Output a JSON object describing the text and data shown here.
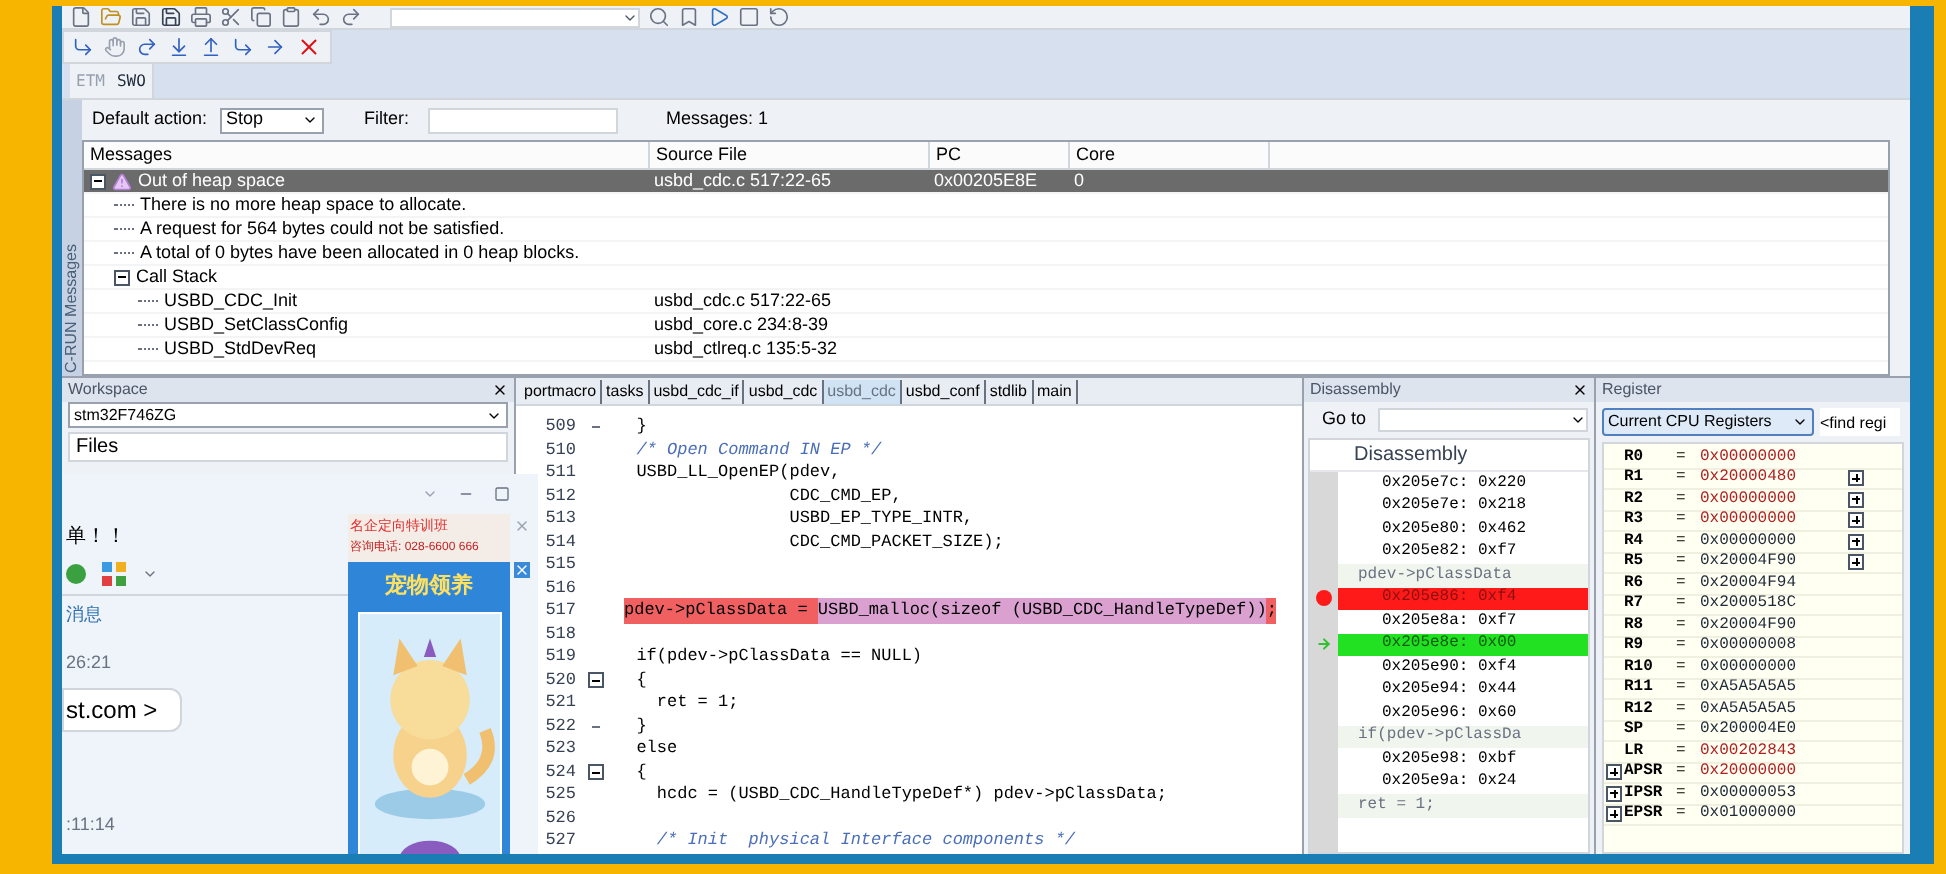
{
  "toolbar_tabs": [
    {
      "label": "ETM",
      "disabled": true
    },
    {
      "label": "SWO",
      "disabled": false
    }
  ],
  "messages_panel": {
    "title": "C-RUN Messages",
    "default_action": {
      "label": "Default action:",
      "value": "Stop"
    },
    "filter": {
      "label": "Filter:"
    },
    "count": "Messages: 1",
    "columns": [
      "Messages",
      "Source File",
      "PC",
      "Core"
    ],
    "rows": [
      {
        "kind": "warning",
        "message": "Out of heap space",
        "source": "usbd_cdc.c 517:22-65",
        "pc": "0x00205E8E",
        "core": "0",
        "selected": true,
        "expanded": true,
        "children": [
          {
            "kind": "text",
            "message": "There is no more heap space to allocate.",
            "selected": false
          },
          {
            "kind": "text",
            "message": "A request for 564 bytes could not be satisfied.",
            "selected": false
          },
          {
            "kind": "text",
            "message": "A total of 0 bytes have been allocated in 0 heap blocks.",
            "selected": false
          },
          {
            "kind": "group",
            "message": "Call Stack",
            "selected": false,
            "expanded": true,
            "children": [
              {
                "kind": "text",
                "message": "USBD_CDC_Init",
                "source": "usbd_cdc.c 517:22-65",
                "selected": false
              },
              {
                "kind": "text",
                "message": "USBD_SetClassConfig",
                "source": "usbd_core.c 234:8-39",
                "selected": false
              },
              {
                "kind": "text",
                "message": "USBD_StdDevReq",
                "source": "usbd_ctlreq.c 135:5-32",
                "selected": false
              }
            ]
          }
        ]
      }
    ]
  },
  "workspace": {
    "title": "Workspace",
    "project": "stm32F746ZG",
    "files_label": "Files"
  },
  "chat_window": {
    "heading": "单！！",
    "link": "消息",
    "time_1": "26:21",
    "bubble": "st.com >",
    "time_2": ":11:14",
    "ad": {
      "line_1": "名企定向特训班",
      "line_2": "咨询电话: 028-6600 666",
      "banner": "宠物领养"
    }
  },
  "editor": {
    "tabs": [
      {
        "label": "portmacro",
        "selected": false
      },
      {
        "label": "tasks",
        "selected": false
      },
      {
        "label": "usbd_cdc_if",
        "selected": false
      },
      {
        "label": "usbd_cdc",
        "selected": false
      },
      {
        "label": "usbd_cdc",
        "selected": true
      },
      {
        "label": "usbd_conf",
        "selected": false
      },
      {
        "label": "stdlib",
        "selected": false
      },
      {
        "label": "main",
        "selected": false
      }
    ],
    "lines": [
      {
        "number": "509",
        "fold_start": false,
        "fold_end": true,
        "kind": "code",
        "text": "  }"
      },
      {
        "number": "510",
        "fold_start": false,
        "fold_end": false,
        "kind": "comment",
        "text": "  /* Open Command IN EP */"
      },
      {
        "number": "511",
        "fold_start": false,
        "fold_end": false,
        "kind": "code",
        "text": "  USBD_LL_OpenEP(pdev,"
      },
      {
        "number": "512",
        "fold_start": false,
        "fold_end": false,
        "kind": "code",
        "text": "                 CDC_CMD_EP,"
      },
      {
        "number": "513",
        "fold_start": false,
        "fold_end": false,
        "kind": "code",
        "text": "                 USBD_EP_TYPE_INTR,"
      },
      {
        "number": "514",
        "fold_start": false,
        "fold_end": false,
        "kind": "code",
        "text": "                 CDC_CMD_PACKET_SIZE);"
      },
      {
        "number": "515",
        "fold_start": false,
        "fold_end": false
      },
      {
        "number": "516",
        "fold_start": false,
        "fold_end": false
      },
      {
        "number": "517",
        "fold_start": false,
        "fold_end": false,
        "segments": [
          {
            "text": "pdev->pClassData = ",
            "color": "#f06060"
          },
          {
            "text": "USBD_malloc(sizeof (USBD_CDC_HandleTypeDef))",
            "color": "#d9a0d0"
          },
          {
            "text": ";",
            "color": "#f06060"
          }
        ]
      },
      {
        "number": "518",
        "fold_start": false,
        "fold_end": false
      },
      {
        "number": "519",
        "fold_start": false,
        "fold_end": false,
        "kind": "code",
        "text": "  if(pdev->pClassData == NULL)"
      },
      {
        "number": "520",
        "fold_start": true,
        "fold_end": false,
        "kind": "code",
        "text": "  {"
      },
      {
        "number": "521",
        "fold_start": false,
        "fold_end": false,
        "kind": "code",
        "text": "    ret = 1;"
      },
      {
        "number": "522",
        "fold_start": false,
        "fold_end": true,
        "kind": "code",
        "text": "  }"
      },
      {
        "number": "523",
        "fold_start": false,
        "fold_end": false,
        "kind": "code",
        "text": "  else"
      },
      {
        "number": "524",
        "fold_start": true,
        "fold_end": false,
        "kind": "code",
        "text": "  {"
      },
      {
        "number": "525",
        "fold_start": false,
        "fold_end": false,
        "kind": "code",
        "text": "    hcdc = (USBD_CDC_HandleTypeDef*) pdev->pClassData;"
      },
      {
        "number": "526",
        "fold_start": false,
        "fold_end": false
      },
      {
        "number": "527",
        "fold_start": false,
        "fold_end": false,
        "kind": "comment",
        "text": "    /* Init  physical Interface components */"
      }
    ]
  },
  "disassembly": {
    "title": "Disassembly",
    "goto_label": "Go to",
    "header": "Disassembly",
    "rows": [
      {
        "kind": "instr",
        "text": "0x205e7c: 0x220",
        "breakpoint": false,
        "current": false
      },
      {
        "kind": "instr",
        "text": "0x205e7e: 0x218",
        "breakpoint": false,
        "current": false
      },
      {
        "kind": "instr",
        "text": "0x205e80: 0x462",
        "breakpoint": false,
        "current": false
      },
      {
        "kind": "instr",
        "text": "0x205e82: 0xf7",
        "breakpoint": false,
        "current": false
      },
      {
        "kind": "source",
        "text": "pdev->pClassData",
        "breakpoint": false,
        "current": false
      },
      {
        "kind": "instr",
        "text": "0x205e86: 0xf4",
        "breakpoint": true,
        "current": false
      },
      {
        "kind": "instr",
        "text": "0x205e8a: 0xf7",
        "breakpoint": false,
        "current": false
      },
      {
        "kind": "instr",
        "text": "0x205e8e: 0x00",
        "breakpoint": false,
        "current": true
      },
      {
        "kind": "instr",
        "text": "0x205e90: 0xf4",
        "breakpoint": false,
        "current": false
      },
      {
        "kind": "instr",
        "text": "0x205e94: 0x44",
        "breakpoint": false,
        "current": false
      },
      {
        "kind": "instr",
        "text": "0x205e96: 0x60",
        "breakpoint": false,
        "current": false
      },
      {
        "kind": "source",
        "text": "if(pdev->pClassDa",
        "breakpoint": false,
        "current": false
      },
      {
        "kind": "instr",
        "text": "0x205e98: 0xbf",
        "breakpoint": false,
        "current": false
      },
      {
        "kind": "instr",
        "text": "0x205e9a: 0x24",
        "breakpoint": false,
        "current": false
      },
      {
        "kind": "source",
        "text": "ret = 1;",
        "breakpoint": false,
        "current": false
      }
    ]
  },
  "registers": {
    "title": "Register",
    "group": "Current CPU Registers",
    "find_placeholder": "<find regi",
    "rows": [
      {
        "name": "R0",
        "sign": "=",
        "value": "0x00000000",
        "changed": true,
        "expand_left": false,
        "expand_right": false
      },
      {
        "name": "R1",
        "sign": "=",
        "value": "0x20000480",
        "changed": true,
        "expand_left": false,
        "expand_right": true
      },
      {
        "name": "R2",
        "sign": "=",
        "value": "0x00000000",
        "changed": true,
        "expand_left": false,
        "expand_right": true
      },
      {
        "name": "R3",
        "sign": "=",
        "value": "0x00000000",
        "changed": true,
        "expand_left": false,
        "expand_right": true
      },
      {
        "name": "R4",
        "sign": "=",
        "value": "0x00000000",
        "changed": false,
        "expand_left": false,
        "expand_right": true
      },
      {
        "name": "R5",
        "sign": "=",
        "value": "0x20004F90",
        "changed": false,
        "expand_left": false,
        "expand_right": true
      },
      {
        "name": "R6",
        "sign": "=",
        "value": "0x20004F94",
        "changed": false,
        "expand_left": false,
        "expand_right": false
      },
      {
        "name": "R7",
        "sign": "=",
        "value": "0x2000518C",
        "changed": false,
        "expand_left": false,
        "expand_right": false
      },
      {
        "name": "R8",
        "sign": "=",
        "value": "0x20004F90",
        "changed": false,
        "expand_left": false,
        "expand_right": false
      },
      {
        "name": "R9",
        "sign": "=",
        "value": "0x00000008",
        "changed": false,
        "expand_left": false,
        "expand_right": false
      },
      {
        "name": "R10",
        "sign": "=",
        "value": "0x00000000",
        "changed": false,
        "expand_left": false,
        "expand_right": false
      },
      {
        "name": "R11",
        "sign": "=",
        "value": "0xA5A5A5A5",
        "changed": false,
        "expand_left": false,
        "expand_right": false
      },
      {
        "name": "R12",
        "sign": "=",
        "value": "0xA5A5A5A5",
        "changed": false,
        "expand_left": false,
        "expand_right": false
      },
      {
        "name": "SP",
        "sign": "=",
        "value": "0x200004E0",
        "changed": false,
        "expand_left": false,
        "expand_right": false
      },
      {
        "name": "LR",
        "sign": "=",
        "value": "0x00202843",
        "changed": true,
        "expand_left": false,
        "expand_right": false
      },
      {
        "name": "APSR",
        "sign": "=",
        "value": "0x20000000",
        "changed": true,
        "expand_left": true,
        "expand_right": false
      },
      {
        "name": "IPSR",
        "sign": "=",
        "value": "0x00000053",
        "changed": false,
        "expand_left": true,
        "expand_right": false
      },
      {
        "name": "EPSR",
        "sign": "=",
        "value": "0x01000000",
        "changed": false,
        "expand_left": true,
        "expand_right": false
      }
    ]
  }
}
